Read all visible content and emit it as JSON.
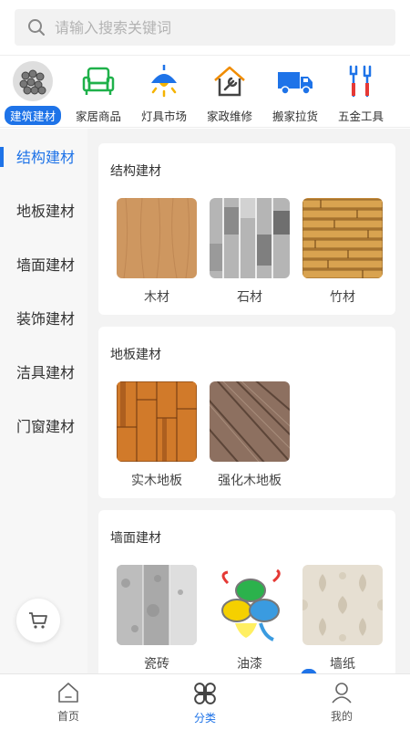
{
  "search": {
    "placeholder": "请输入搜索关键词"
  },
  "categories": [
    {
      "label": "建筑建材",
      "icon": "steel-pipes-icon",
      "active": true
    },
    {
      "label": "家居商品",
      "icon": "armchair-icon"
    },
    {
      "label": "灯具市场",
      "icon": "ceiling-lamp-icon"
    },
    {
      "label": "家政维修",
      "icon": "house-wrench-icon"
    },
    {
      "label": "搬家拉货",
      "icon": "truck-icon"
    },
    {
      "label": "五金工具",
      "icon": "tools-icon"
    }
  ],
  "side_nav": [
    {
      "label": "结构建材",
      "active": true
    },
    {
      "label": "地板建材"
    },
    {
      "label": "墙面建材"
    },
    {
      "label": "装饰建材"
    },
    {
      "label": "洁具建材"
    },
    {
      "label": "门窗建材"
    }
  ],
  "sections": [
    {
      "title": "结构建材",
      "items": [
        {
          "label": "木材",
          "image": "wood-texture"
        },
        {
          "label": "石材",
          "image": "stone-texture"
        },
        {
          "label": "竹材",
          "image": "bamboo-texture"
        }
      ]
    },
    {
      "title": "地板建材",
      "items": [
        {
          "label": "实木地板",
          "image": "solid-wood-floor"
        },
        {
          "label": "强化木地板",
          "image": "laminate-floor"
        }
      ]
    },
    {
      "title": "墙面建材",
      "items": [
        {
          "label": "瓷砖",
          "image": "tile-texture"
        },
        {
          "label": "油漆",
          "image": "paint-cans"
        },
        {
          "label": "墙纸",
          "image": "wallpaper-texture"
        }
      ]
    }
  ],
  "tabs": [
    {
      "label": "首页",
      "icon": "home-icon"
    },
    {
      "label": "分类",
      "icon": "category-icon",
      "active": true
    },
    {
      "label": "我的",
      "icon": "profile-icon"
    }
  ],
  "colors": {
    "accent": "#1e73e8",
    "side_bg": "#f7f7f7",
    "content_bg": "#f3f3f3"
  }
}
